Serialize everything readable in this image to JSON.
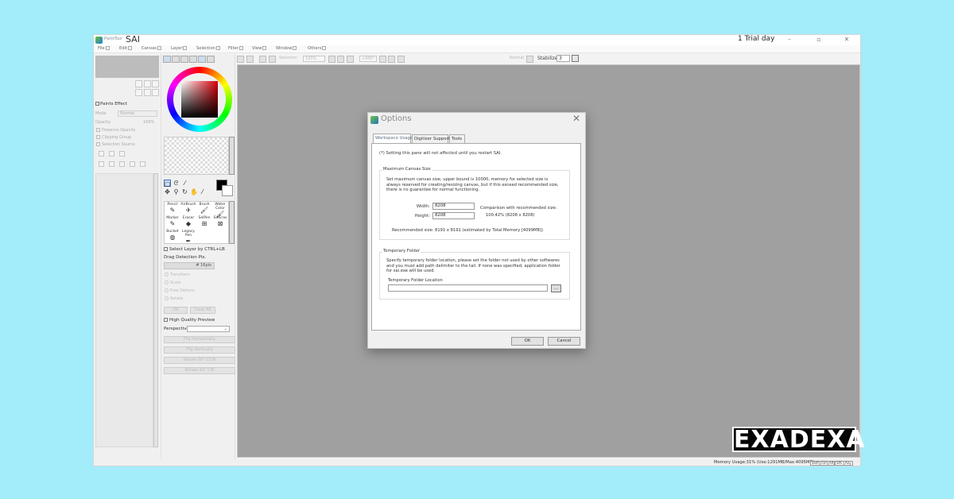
{
  "app": {
    "brand": "PaintTool",
    "title": "SAI",
    "trial": "1 Trial day",
    "controls": {
      "minimize": "–",
      "maximize": "▫",
      "close": "✕"
    }
  },
  "menu": [
    {
      "label": "File",
      "key": "F"
    },
    {
      "label": "Edit",
      "key": "E"
    },
    {
      "label": "Canvas",
      "key": "C"
    },
    {
      "label": "Layer",
      "key": "L"
    },
    {
      "label": "Selection",
      "key": "S"
    },
    {
      "label": "Filter",
      "key": "T"
    },
    {
      "label": "View",
      "key": "V"
    },
    {
      "label": "Window",
      "key": "W"
    },
    {
      "label": "Others",
      "key": "O"
    }
  ],
  "toolbar": {
    "selection_label": "Selection",
    "zoom": "100%",
    "rotate": "+000°",
    "normal_label": "Normal",
    "stabilizer_label": "Stabilizer",
    "stabilizer_value": "3"
  },
  "left_panel": {
    "paints_effect": "Paints Effect",
    "mode_label": "Mode",
    "mode_value": "Normal",
    "opacity_label": "Opacity",
    "opacity_value": "100%",
    "checks": [
      "Preserve Opacity",
      "Clipping Group",
      "Selection Source"
    ]
  },
  "tool_panel": {
    "brushes": [
      {
        "name": "Pencil",
        "glyph": "✎"
      },
      {
        "name": "AirBrush",
        "glyph": "✈"
      },
      {
        "name": "Brush",
        "glyph": "🖌"
      },
      {
        "name": "Water Color",
        "glyph": "🖌"
      },
      {
        "name": "Marker",
        "glyph": "✎"
      },
      {
        "name": "Eraser",
        "glyph": "◆"
      },
      {
        "name": "SelPen",
        "glyph": "⊞"
      },
      {
        "name": "SelEras",
        "glyph": "⊠"
      },
      {
        "name": "Bucket",
        "glyph": "◍"
      },
      {
        "name": "Legacy Pen",
        "glyph": "✒"
      }
    ],
    "select_layer_ctrl": "Select Layer by CTRL+LB",
    "drag_detection_label": "Drag Detection Pix.",
    "drag_detection_value": "# 16pix",
    "transforms": [
      "Transform",
      "Scale",
      "Free Deform",
      "Rotate"
    ],
    "ok_label": "OK",
    "clear_all_label": "Clear All",
    "high_quality_preview": "High Quality Preview",
    "perspective_label": "Perspective",
    "buttons": [
      "Flip Horizontally",
      "Flip Vertically",
      "Rotate 90° CCW",
      "Rotate 90° CW"
    ]
  },
  "dialog": {
    "title": "Options",
    "tabs": [
      "Workspace Usage",
      "Digitizer Support",
      "Tools"
    ],
    "restart_note": "(*) Setting this pane will not affected until you restart SAI.",
    "max_canvas": {
      "title": "Maximum Canvas Size",
      "description": "Set maximum canvas size, upper bound is 10000, memory for selected size is always reserved for creating/resizing canvas, but if this exceed recommended size, there is no guarantee for normal functioning.",
      "width_label": "Width:",
      "width_value": "8208",
      "height_label": "Height:",
      "height_value": "8208",
      "comparison_label": "Comparison with recommended size:",
      "comparison_value": "100.42% (8208 x 8208)",
      "recommended": "Recommended size:  8191 x 8191 (estimated by Total Memory [4099MB])"
    },
    "temp_folder": {
      "title": "Temporary Folder",
      "description": "Specify temporary folder location, please set the folder not used by other softwares and you must add path delimiter to the tail. If none was specified, application folder for sai.exe will be used.",
      "location_label": "Temporary Folder Location",
      "location_value": "",
      "browse_label": "..."
    },
    "ok_label": "OK",
    "cancel_label": "Cancel",
    "close": "✕"
  },
  "status": {
    "memory": "Memory Usage:31% (Use:1291MB/Max:4095MB)",
    "keys": [
      "Shift",
      "Ctrl",
      "Alt",
      "SPC",
      "Any"
    ]
  },
  "watermark": {
    "text": "EXADEXA"
  }
}
